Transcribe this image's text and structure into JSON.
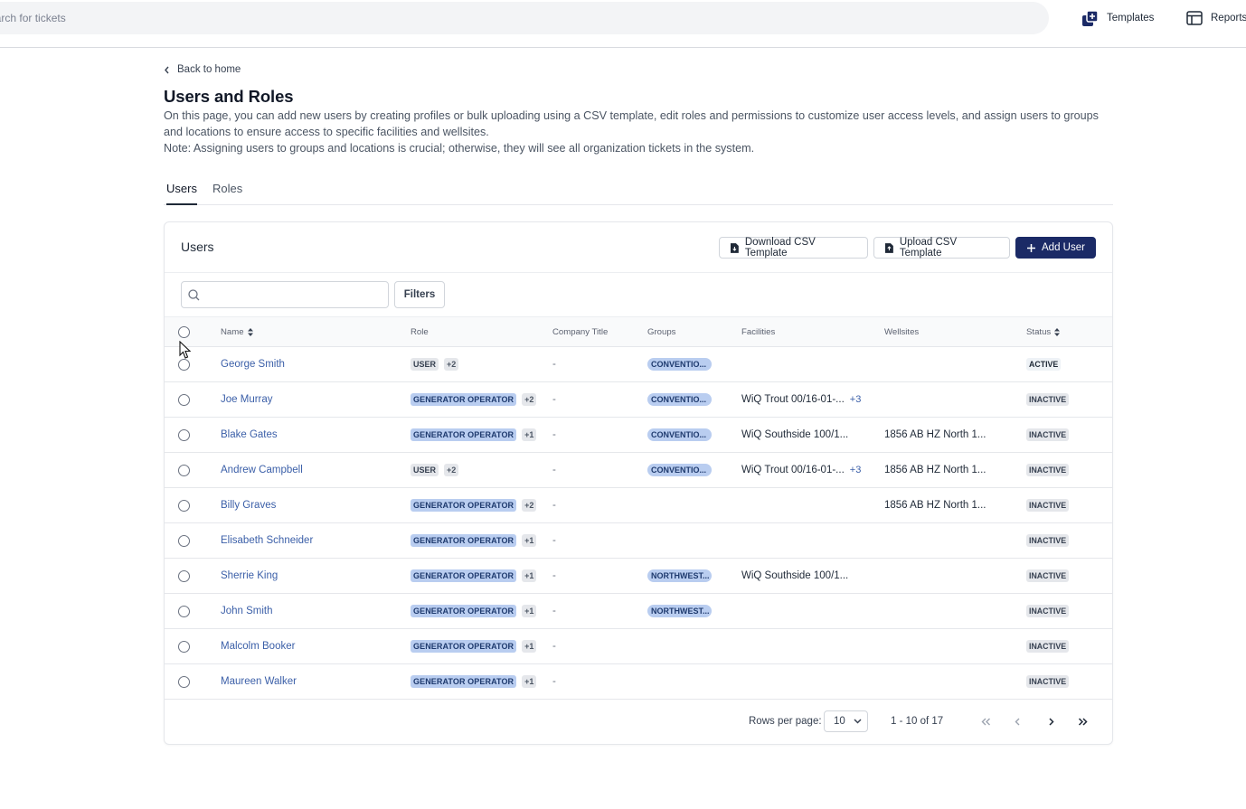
{
  "topbar": {
    "search_placeholder": "Search for tickets",
    "templates_label": "Templates",
    "reports_label": "Reports"
  },
  "page": {
    "back_label": "Back to home",
    "title": "Users and Roles",
    "description_line1": "On this page, you can add new users by creating profiles or bulk uploading using a CSV template, edit roles and permissions to customize user access levels, and assign users to groups and locations to ensure access to specific facilities and wellsites.",
    "description_line2": "Note: Assigning users to groups and locations is crucial; otherwise, they will see all organization tickets in the system."
  },
  "tabs": [
    {
      "label": "Users",
      "active": true
    },
    {
      "label": "Roles",
      "active": false
    }
  ],
  "card": {
    "title": "Users",
    "download_label": "Download CSV Template",
    "upload_label": "Upload CSV Template",
    "add_label": "Add User",
    "filters_label": "Filters"
  },
  "columns": {
    "name": "Name",
    "role": "Role",
    "company_title": "Company Title",
    "groups": "Groups",
    "facilities": "Facilities",
    "wellsites": "Wellsites",
    "status": "Status"
  },
  "rows": [
    {
      "name": "George Smith",
      "role": "USER",
      "role_type": "user",
      "role_more": "+2",
      "title": "-",
      "group": "CONVENTIO...",
      "facility": "",
      "facility_more": "",
      "wellsite": "",
      "status": "ACTIVE"
    },
    {
      "name": "Joe Murray",
      "role": "GENERATOR OPERATOR",
      "role_type": "operator",
      "role_more": "+2",
      "title": "-",
      "group": "CONVENTIO...",
      "facility": "WiQ Trout 00/16-01-...",
      "facility_more": "+3",
      "wellsite": "",
      "status": "INACTIVE"
    },
    {
      "name": "Blake Gates",
      "role": "GENERATOR OPERATOR",
      "role_type": "operator",
      "role_more": "+1",
      "title": "-",
      "group": "CONVENTIO...",
      "facility": "WiQ Southside 100/1...",
      "facility_more": "",
      "wellsite": "1856 AB HZ North 1...",
      "status": "INACTIVE"
    },
    {
      "name": "Andrew Campbell",
      "role": "USER",
      "role_type": "user",
      "role_more": "+2",
      "title": "-",
      "group": "CONVENTIO...",
      "facility": "WiQ Trout 00/16-01-...",
      "facility_more": "+3",
      "wellsite": "1856 AB HZ North 1...",
      "status": "INACTIVE"
    },
    {
      "name": "Billy Graves",
      "role": "GENERATOR OPERATOR",
      "role_type": "operator",
      "role_more": "+2",
      "title": "-",
      "group": "",
      "facility": "",
      "facility_more": "",
      "wellsite": "1856 AB HZ North 1...",
      "status": "INACTIVE"
    },
    {
      "name": "Elisabeth Schneider",
      "role": "GENERATOR OPERATOR",
      "role_type": "operator",
      "role_more": "+1",
      "title": "-",
      "group": "",
      "facility": "",
      "facility_more": "",
      "wellsite": "",
      "status": "INACTIVE"
    },
    {
      "name": "Sherrie King",
      "role": "GENERATOR OPERATOR",
      "role_type": "operator",
      "role_more": "+1",
      "title": "-",
      "group": "NORTHWEST...",
      "facility": "WiQ Southside 100/1...",
      "facility_more": "",
      "wellsite": "",
      "status": "INACTIVE"
    },
    {
      "name": "John Smith",
      "role": "GENERATOR OPERATOR",
      "role_type": "operator",
      "role_more": "+1",
      "title": "-",
      "group": "NORTHWEST...",
      "facility": "",
      "facility_more": "",
      "wellsite": "",
      "status": "INACTIVE"
    },
    {
      "name": "Malcolm Booker",
      "role": "GENERATOR OPERATOR",
      "role_type": "operator",
      "role_more": "+1",
      "title": "-",
      "group": "",
      "facility": "",
      "facility_more": "",
      "wellsite": "",
      "status": "INACTIVE"
    },
    {
      "name": "Maureen Walker",
      "role": "GENERATOR OPERATOR",
      "role_type": "operator",
      "role_more": "+1",
      "title": "-",
      "group": "",
      "facility": "",
      "facility_more": "",
      "wellsite": "",
      "status": "INACTIVE"
    }
  ],
  "pagination": {
    "rows_per_page_label": "Rows per page:",
    "rows_per_page_value": "10",
    "range_label": "1 - 10 of 17"
  },
  "colors": {
    "primary": "#1b2a66",
    "link": "#3b5fa8",
    "chip_blue": "#b9cdf0"
  }
}
